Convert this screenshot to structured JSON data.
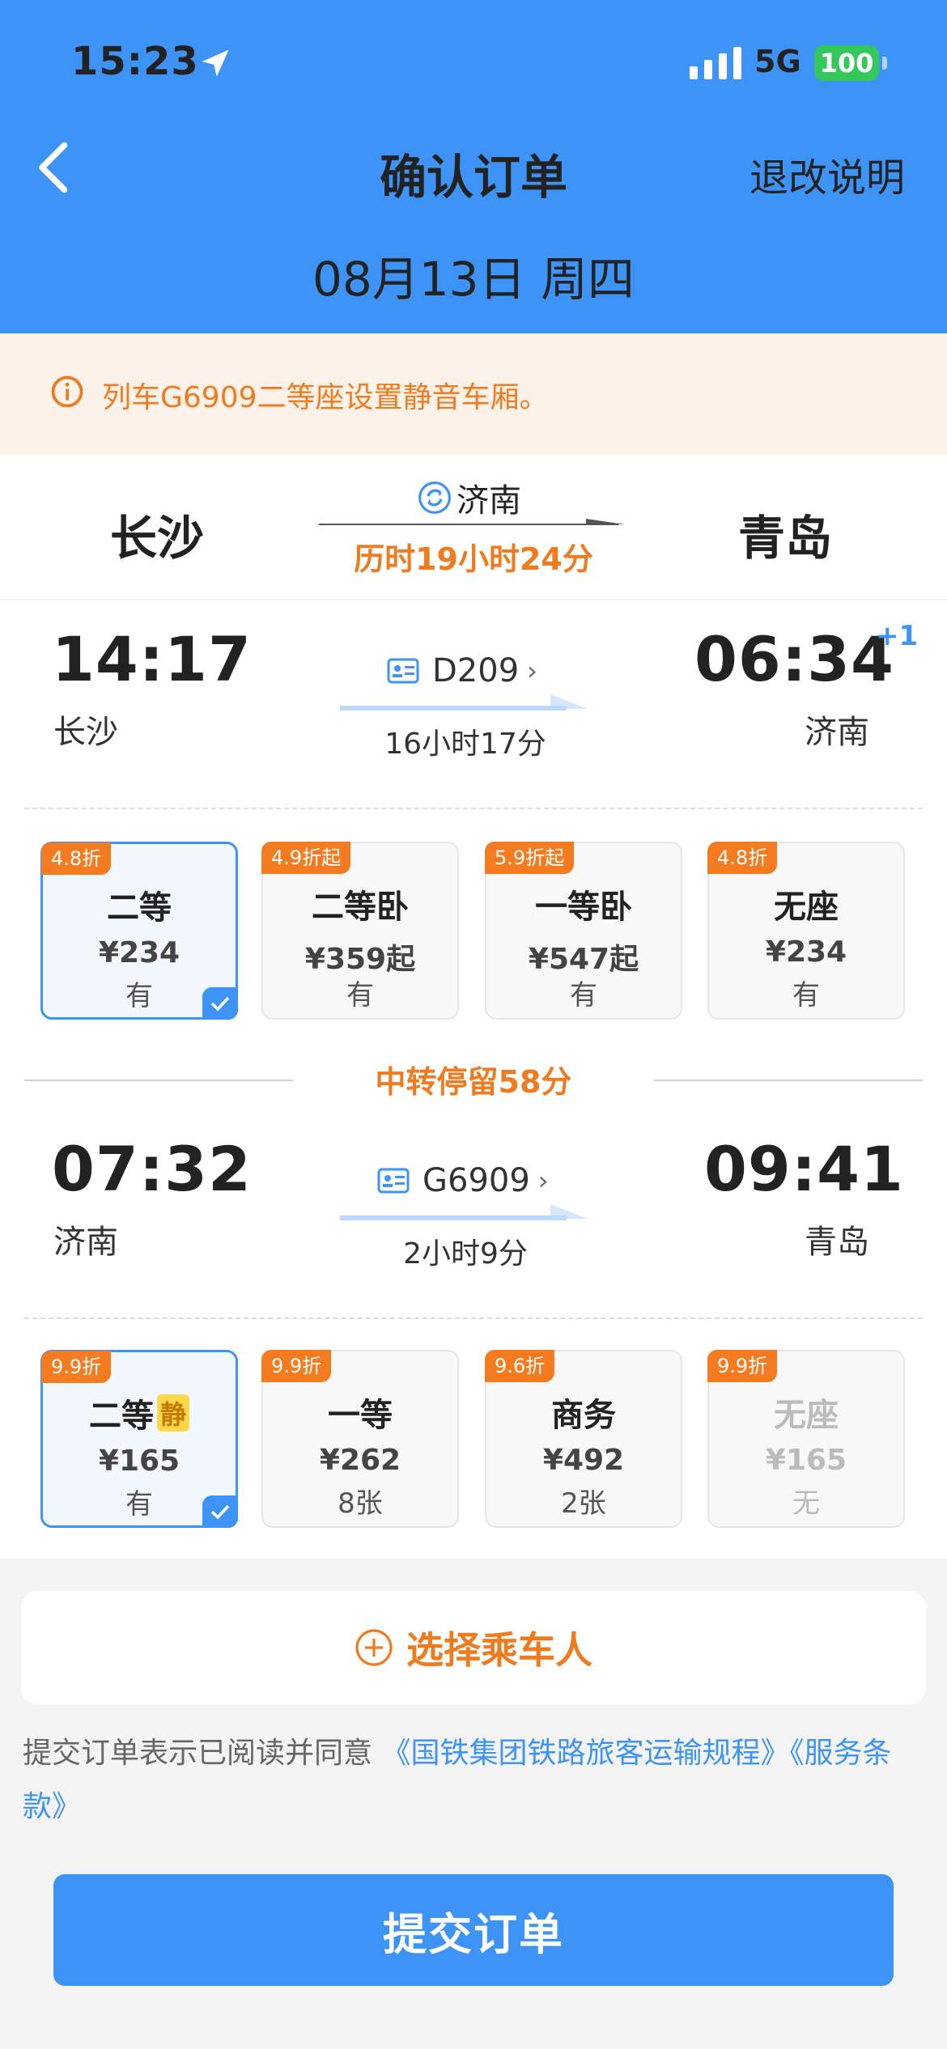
{
  "status_bar": {
    "time": "15:23",
    "network": "5G",
    "battery": "100"
  },
  "nav": {
    "title": "确认订单",
    "refund_link": "退改说明",
    "date": "08月13日 周四"
  },
  "notice": {
    "text": "列车G6909二等座设置静音车厢。"
  },
  "route": {
    "from": "长沙",
    "to": "青岛",
    "via": "济南",
    "total_duration": "历时19小时24分"
  },
  "segments": [
    {
      "depart_time": "14:17",
      "depart_station": "长沙",
      "arrive_time": "06:34",
      "arrive_station": "济南",
      "next_day": "+1",
      "train_no": "D209",
      "duration": "16小时17分",
      "seats": [
        {
          "badge": "4.8折",
          "name": "二等",
          "price": "¥234",
          "avail": "有",
          "selected": true
        },
        {
          "badge": "4.9折起",
          "name": "二等卧",
          "price": "¥359起",
          "avail": "有"
        },
        {
          "badge": "5.9折起",
          "name": "一等卧",
          "price": "¥547起",
          "avail": "有"
        },
        {
          "badge": "4.8折",
          "name": "无座",
          "price": "¥234",
          "avail": "有"
        }
      ]
    },
    {
      "depart_time": "07:32",
      "depart_station": "济南",
      "arrive_time": "09:41",
      "arrive_station": "青岛",
      "train_no": "G6909",
      "duration": "2小时9分",
      "seats": [
        {
          "badge": "9.9折",
          "name": "二等",
          "quiet_tag": "静",
          "price": "¥165",
          "avail": "有",
          "selected": true
        },
        {
          "badge": "9.9折",
          "name": "一等",
          "price": "¥262",
          "avail": "8张"
        },
        {
          "badge": "9.6折",
          "name": "商务",
          "price": "¥492",
          "avail": "2张"
        },
        {
          "badge": "9.9折",
          "name": "无座",
          "price": "¥165",
          "avail": "无",
          "disabled": true
        }
      ]
    }
  ],
  "transfer": {
    "text": "中转停留58分"
  },
  "passenger": {
    "label": "选择乘车人"
  },
  "agreement": {
    "prefix": "提交订单表示已阅读并同意",
    "link1": "《国铁集团铁路旅客运输规程》",
    "link2": "《服务条款》"
  },
  "submit": {
    "label": "提交订单"
  },
  "colors": {
    "primary": "#3d94f6",
    "accent": "#f07b1f",
    "badge": "#f47b20",
    "notice_bg": "#fdf2ea"
  }
}
